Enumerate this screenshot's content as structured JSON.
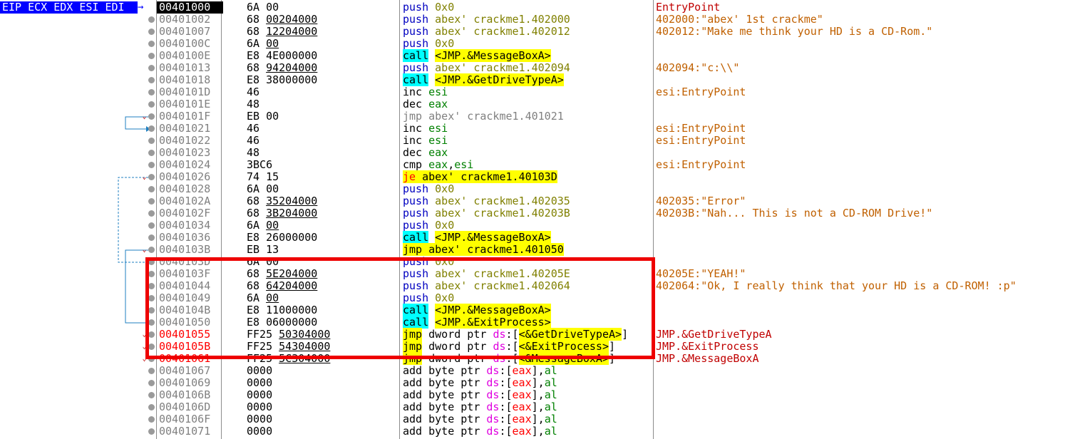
{
  "registers_label": "EIP ECX EDX ESI EDI",
  "register_arrow": "→",
  "colors": {
    "highlight_box": "#ee0000",
    "jump_line": "#1f7fc0",
    "current_addr_bg": "#000000",
    "register_label_bg": "#0000ff"
  },
  "rows": [
    {
      "addr": "00401000",
      "current": true,
      "bytes": [
        {
          "t": "6A 00"
        }
      ],
      "asm": [
        {
          "t": "push",
          "c": "blue"
        },
        {
          "t": " 0x0",
          "c": "olive"
        }
      ],
      "comment": [
        {
          "t": "EntryPoint",
          "c": "dred"
        }
      ]
    },
    {
      "addr": "00401002",
      "bytes": [
        {
          "t": "68 "
        },
        {
          "t": "00204000",
          "u": true
        }
      ],
      "asm": [
        {
          "t": "push",
          "c": "blue"
        },
        {
          "t": " abex' crackme1.402000",
          "c": "olive"
        }
      ],
      "comment": [
        {
          "t": "402000:\"abex' 1st crackme\"",
          "c": "orange"
        }
      ]
    },
    {
      "addr": "00401007",
      "bytes": [
        {
          "t": "68 "
        },
        {
          "t": "12204000",
          "u": true
        }
      ],
      "asm": [
        {
          "t": "push",
          "c": "blue"
        },
        {
          "t": " abex' crackme1.402012",
          "c": "olive"
        }
      ],
      "comment": [
        {
          "t": "402012:\"Make me think your HD is a CD-Rom.\"",
          "c": "orange"
        }
      ]
    },
    {
      "addr": "0040100C",
      "bytes": [
        {
          "t": "6A "
        },
        {
          "t": "00",
          "u": true
        }
      ],
      "asm": [
        {
          "t": "push",
          "c": "blue"
        },
        {
          "t": " 0x0",
          "c": "olive"
        }
      ],
      "comment": []
    },
    {
      "addr": "0040100E",
      "bytes": [
        {
          "t": "E8 4E000000"
        }
      ],
      "asm": [
        {
          "t": "call",
          "c": "black",
          "bg": "cyan"
        },
        {
          "t": " "
        },
        {
          "t": "<JMP.&MessageBoxA>",
          "c": "black",
          "bg": "yellow"
        }
      ],
      "comment": []
    },
    {
      "addr": "00401013",
      "bytes": [
        {
          "t": "68 "
        },
        {
          "t": "94204000",
          "u": true
        }
      ],
      "asm": [
        {
          "t": "push",
          "c": "blue"
        },
        {
          "t": " abex' crackme1.402094",
          "c": "olive"
        }
      ],
      "comment": [
        {
          "t": "402094:\"c:\\\\\"",
          "c": "orange"
        }
      ]
    },
    {
      "addr": "00401018",
      "bytes": [
        {
          "t": "E8 38000000"
        }
      ],
      "asm": [
        {
          "t": "call",
          "c": "black",
          "bg": "cyan"
        },
        {
          "t": " "
        },
        {
          "t": "<JMP.&GetDriveTypeA>",
          "c": "black",
          "bg": "yellow"
        }
      ],
      "comment": []
    },
    {
      "addr": "0040101D",
      "bytes": [
        {
          "t": "46"
        }
      ],
      "asm": [
        {
          "t": "inc",
          "c": "black"
        },
        {
          "t": " esi",
          "c": "green"
        }
      ],
      "comment": [
        {
          "t": "esi:EntryPoint",
          "c": "orange"
        }
      ]
    },
    {
      "addr": "0040101E",
      "bytes": [
        {
          "t": "48"
        }
      ],
      "asm": [
        {
          "t": "dec",
          "c": "black"
        },
        {
          "t": " eax",
          "c": "green"
        }
      ],
      "comment": []
    },
    {
      "addr": "0040101F",
      "arrow": "v",
      "bytes": [
        {
          "t": "EB 00"
        }
      ],
      "asm": [
        {
          "t": "jmp abex' crackme1.401021",
          "c": "gray"
        }
      ],
      "comment": []
    },
    {
      "addr": "00401021",
      "bytes": [
        {
          "t": "46"
        }
      ],
      "asm": [
        {
          "t": "inc",
          "c": "black"
        },
        {
          "t": " esi",
          "c": "green"
        }
      ],
      "comment": [
        {
          "t": "esi:EntryPoint",
          "c": "orange"
        }
      ]
    },
    {
      "addr": "00401022",
      "bytes": [
        {
          "t": "46"
        }
      ],
      "asm": [
        {
          "t": "inc",
          "c": "black"
        },
        {
          "t": " esi",
          "c": "green"
        }
      ],
      "comment": [
        {
          "t": "esi:EntryPoint",
          "c": "orange"
        }
      ]
    },
    {
      "addr": "00401023",
      "bytes": [
        {
          "t": "48"
        }
      ],
      "asm": [
        {
          "t": "dec",
          "c": "black"
        },
        {
          "t": " eax",
          "c": "green"
        }
      ],
      "comment": []
    },
    {
      "addr": "00401024",
      "bytes": [
        {
          "t": "3BC6"
        }
      ],
      "asm": [
        {
          "t": "cmp",
          "c": "black"
        },
        {
          "t": " eax",
          "c": "green"
        },
        {
          "t": ",",
          "c": "black"
        },
        {
          "t": "esi",
          "c": "green"
        }
      ],
      "comment": [
        {
          "t": "esi:EntryPoint",
          "c": "orange"
        }
      ]
    },
    {
      "addr": "00401026",
      "arrow": "v",
      "bytes": [
        {
          "t": "74 15"
        }
      ],
      "asm": [
        {
          "t": "je",
          "c": "red",
          "bg": "yellow"
        },
        {
          "t": " abex' crackme1.40103D",
          "c": "black",
          "bg": "yellow"
        }
      ],
      "comment": []
    },
    {
      "addr": "00401028",
      "bytes": [
        {
          "t": "6A 00"
        }
      ],
      "asm": [
        {
          "t": "push",
          "c": "blue"
        },
        {
          "t": " 0x0",
          "c": "olive"
        }
      ],
      "comment": []
    },
    {
      "addr": "0040102A",
      "bytes": [
        {
          "t": "68 "
        },
        {
          "t": "35204000",
          "u": true
        }
      ],
      "asm": [
        {
          "t": "push",
          "c": "blue"
        },
        {
          "t": " abex' crackme1.402035",
          "c": "olive"
        }
      ],
      "comment": [
        {
          "t": "402035:\"Error\"",
          "c": "orange"
        }
      ]
    },
    {
      "addr": "0040102F",
      "bytes": [
        {
          "t": "68 "
        },
        {
          "t": "3B204000",
          "u": true
        }
      ],
      "asm": [
        {
          "t": "push",
          "c": "blue"
        },
        {
          "t": " abex' crackme1.40203B",
          "c": "olive"
        }
      ],
      "comment": [
        {
          "t": "40203B:\"Nah... This is not a CD-ROM Drive!\"",
          "c": "orange"
        }
      ]
    },
    {
      "addr": "00401034",
      "bytes": [
        {
          "t": "6A "
        },
        {
          "t": "00",
          "u": true
        }
      ],
      "asm": [
        {
          "t": "push",
          "c": "blue"
        },
        {
          "t": " 0x0",
          "c": "olive"
        }
      ],
      "comment": []
    },
    {
      "addr": "00401036",
      "bytes": [
        {
          "t": "E8 26000000"
        }
      ],
      "asm": [
        {
          "t": "call",
          "c": "black",
          "bg": "cyan"
        },
        {
          "t": " "
        },
        {
          "t": "<JMP.&MessageBoxA>",
          "c": "black",
          "bg": "yellow"
        }
      ],
      "comment": []
    },
    {
      "addr": "0040103B",
      "arrow": "v",
      "bytes": [
        {
          "t": "EB 13"
        }
      ],
      "asm": [
        {
          "t": "jmp",
          "c": "black",
          "bg": "yellow"
        },
        {
          "t": " abex' crackme1.401050",
          "c": "black",
          "bg": "yellow"
        }
      ],
      "comment": []
    },
    {
      "addr": "0040103D",
      "bytes": [
        {
          "t": "6A 00"
        }
      ],
      "asm": [
        {
          "t": "push",
          "c": "blue"
        },
        {
          "t": " 0x0",
          "c": "olive"
        }
      ],
      "comment": []
    },
    {
      "addr": "0040103F",
      "bytes": [
        {
          "t": "68 "
        },
        {
          "t": "5E204000",
          "u": true
        }
      ],
      "asm": [
        {
          "t": "push",
          "c": "blue"
        },
        {
          "t": " abex' crackme1.40205E",
          "c": "olive"
        }
      ],
      "comment": [
        {
          "t": "40205E:\"YEAH!\"",
          "c": "orange"
        }
      ]
    },
    {
      "addr": "00401044",
      "bytes": [
        {
          "t": "68 "
        },
        {
          "t": "64204000",
          "u": true
        }
      ],
      "asm": [
        {
          "t": "push",
          "c": "blue"
        },
        {
          "t": " abex' crackme1.402064",
          "c": "olive"
        }
      ],
      "comment": [
        {
          "t": "402064:\"Ok, I really think that your HD is a CD-ROM! :p\"",
          "c": "orange"
        }
      ]
    },
    {
      "addr": "00401049",
      "bytes": [
        {
          "t": "6A "
        },
        {
          "t": "00",
          "u": true
        }
      ],
      "asm": [
        {
          "t": "push",
          "c": "blue"
        },
        {
          "t": " 0x0",
          "c": "olive"
        }
      ],
      "comment": []
    },
    {
      "addr": "0040104B",
      "bytes": [
        {
          "t": "E8 11000000"
        }
      ],
      "asm": [
        {
          "t": "call",
          "c": "black",
          "bg": "cyan"
        },
        {
          "t": " "
        },
        {
          "t": "<JMP.&MessageBoxA>",
          "c": "black",
          "bg": "yellow"
        }
      ],
      "comment": []
    },
    {
      "addr": "00401050",
      "bytes": [
        {
          "t": "E8 06000000"
        }
      ],
      "asm": [
        {
          "t": "call",
          "c": "black",
          "bg": "cyan"
        },
        {
          "t": " "
        },
        {
          "t": "<JMP.&ExitProcess>",
          "c": "black",
          "bg": "yellow"
        }
      ],
      "comment": []
    },
    {
      "addr": "00401055",
      "addr_red": true,
      "arrow": "v",
      "bytes": [
        {
          "t": "FF25 "
        },
        {
          "t": "50304000",
          "u": true
        }
      ],
      "asm": [
        {
          "t": "jmp",
          "c": "black",
          "bg": "yellow"
        },
        {
          "t": " dword ptr ",
          "c": "black"
        },
        {
          "t": "ds",
          "c": "pink"
        },
        {
          "t": ":[",
          "c": "black"
        },
        {
          "t": "<&GetDriveTypeA>",
          "c": "black",
          "bg": "yellow"
        },
        {
          "t": "]",
          "c": "black"
        }
      ],
      "comment": [
        {
          "t": "JMP.&GetDriveTypeA",
          "c": "dred"
        }
      ]
    },
    {
      "addr": "0040105B",
      "addr_red": true,
      "arrow": "v",
      "bytes": [
        {
          "t": "FF25 "
        },
        {
          "t": "54304000",
          "u": true
        }
      ],
      "asm": [
        {
          "t": "jmp",
          "c": "black",
          "bg": "yellow"
        },
        {
          "t": " dword ptr ",
          "c": "black"
        },
        {
          "t": "ds",
          "c": "pink"
        },
        {
          "t": ":[",
          "c": "black"
        },
        {
          "t": "<&ExitProcess>",
          "c": "black",
          "bg": "yellow"
        },
        {
          "t": "]",
          "c": "black"
        }
      ],
      "comment": [
        {
          "t": "JMP.&ExitProcess",
          "c": "dred"
        }
      ]
    },
    {
      "addr": "00401061",
      "addr_red": true,
      "arrow": "v",
      "bytes": [
        {
          "t": "FF25 "
        },
        {
          "t": "5C304000",
          "u": true
        }
      ],
      "asm": [
        {
          "t": "jmp",
          "c": "black",
          "bg": "yellow"
        },
        {
          "t": " dword ptr ",
          "c": "black"
        },
        {
          "t": "ds",
          "c": "pink"
        },
        {
          "t": ":[",
          "c": "black"
        },
        {
          "t": "<&MessageBoxA>",
          "c": "black",
          "bg": "yellow"
        },
        {
          "t": "]",
          "c": "black"
        }
      ],
      "comment": [
        {
          "t": "JMP.&MessageBoxA",
          "c": "dred"
        }
      ]
    },
    {
      "addr": "00401067",
      "bytes": [
        {
          "t": "0000"
        }
      ],
      "asm": [
        {
          "t": "add byte ptr ",
          "c": "black"
        },
        {
          "t": "ds",
          "c": "pink"
        },
        {
          "t": ":[",
          "c": "black"
        },
        {
          "t": "eax",
          "c": "red"
        },
        {
          "t": "],",
          "c": "black"
        },
        {
          "t": "al",
          "c": "green"
        }
      ],
      "comment": []
    },
    {
      "addr": "00401069",
      "bytes": [
        {
          "t": "0000"
        }
      ],
      "asm": [
        {
          "t": "add byte ptr ",
          "c": "black"
        },
        {
          "t": "ds",
          "c": "pink"
        },
        {
          "t": ":[",
          "c": "black"
        },
        {
          "t": "eax",
          "c": "red"
        },
        {
          "t": "],",
          "c": "black"
        },
        {
          "t": "al",
          "c": "green"
        }
      ],
      "comment": []
    },
    {
      "addr": "0040106B",
      "bytes": [
        {
          "t": "0000"
        }
      ],
      "asm": [
        {
          "t": "add byte ptr ",
          "c": "black"
        },
        {
          "t": "ds",
          "c": "pink"
        },
        {
          "t": ":[",
          "c": "black"
        },
        {
          "t": "eax",
          "c": "red"
        },
        {
          "t": "],",
          "c": "black"
        },
        {
          "t": "al",
          "c": "green"
        }
      ],
      "comment": []
    },
    {
      "addr": "0040106D",
      "bytes": [
        {
          "t": "0000"
        }
      ],
      "asm": [
        {
          "t": "add byte ptr ",
          "c": "black"
        },
        {
          "t": "ds",
          "c": "pink"
        },
        {
          "t": ":[",
          "c": "black"
        },
        {
          "t": "eax",
          "c": "red"
        },
        {
          "t": "],",
          "c": "black"
        },
        {
          "t": "al",
          "c": "green"
        }
      ],
      "comment": []
    },
    {
      "addr": "0040106F",
      "bytes": [
        {
          "t": "0000"
        }
      ],
      "asm": [
        {
          "t": "add byte ptr ",
          "c": "black"
        },
        {
          "t": "ds",
          "c": "pink"
        },
        {
          "t": ":[",
          "c": "black"
        },
        {
          "t": "eax",
          "c": "red"
        },
        {
          "t": "],",
          "c": "black"
        },
        {
          "t": "al",
          "c": "green"
        }
      ],
      "comment": []
    },
    {
      "addr": "00401071",
      "bytes": [
        {
          "t": "0000"
        }
      ],
      "asm": [
        {
          "t": "add byte ptr ",
          "c": "black"
        },
        {
          "t": "ds",
          "c": "pink"
        },
        {
          "t": ":[",
          "c": "black"
        },
        {
          "t": "eax",
          "c": "red"
        },
        {
          "t": "],",
          "c": "black"
        },
        {
          "t": "al",
          "c": "green"
        }
      ],
      "comment": []
    }
  ]
}
